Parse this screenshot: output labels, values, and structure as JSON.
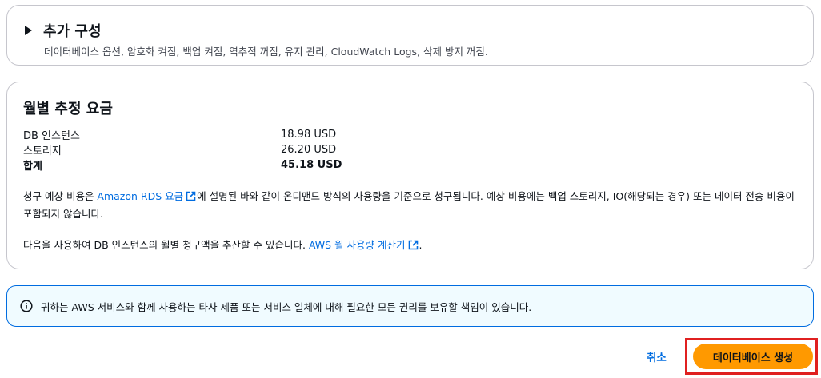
{
  "additional_config": {
    "title": "추가 구성",
    "description": "데이터베이스 옵션, 암호화 켜짐, 백업 켜짐, 역추적 꺼짐, 유지 관리, CloudWatch Logs, 삭제 방지 꺼짐."
  },
  "monthly_cost": {
    "title": "월별 추정 요금",
    "rows": [
      {
        "label": "DB 인스턴스",
        "value": "18.98 USD"
      },
      {
        "label": "스토리지",
        "value": "26.20 USD"
      },
      {
        "label": "합계",
        "value": "45.18 USD"
      }
    ],
    "para1_before": "청구 예상 비용은 ",
    "para1_link": "Amazon RDS 요금",
    "para1_after": "에 설명된 바와 같이 온디맨드 방식의 사용량을 기준으로 청구됩니다. 예상 비용에는 백업 스토리지, IO(해당되는 경우) 또는 데이터 전송 비용이 포함되지 않습니다.",
    "para2_before": "다음을 사용하여 DB 인스턴스의 월별 청구액을 추산할 수 있습니다. ",
    "para2_link": "AWS 월 사용량 계산기",
    "para2_after": "."
  },
  "info": {
    "text": "귀하는 AWS 서비스와 함께 사용하는 타사 제품 또는 서비스 일체에 대해 필요한 모든 권리를 보유할 책임이 있습니다."
  },
  "actions": {
    "cancel_label": "취소",
    "create_label": "데이터베이스 생성"
  },
  "colors": {
    "primary_button": "#ff9900",
    "link": "#006ce0",
    "info_border": "#006ce0",
    "info_background": "#f0fbff",
    "highlight": "#e02020"
  }
}
